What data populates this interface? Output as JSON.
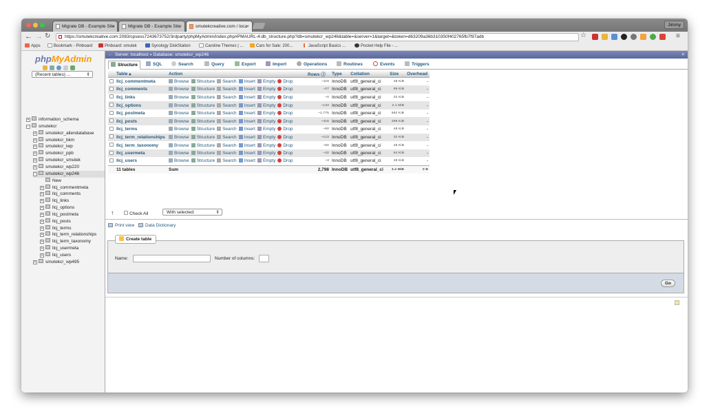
{
  "browser": {
    "tabs": [
      {
        "label": "Migrate DB - Example Site",
        "active": false
      },
      {
        "label": "Migrate DB - Example Site",
        "active": false
      },
      {
        "label": "smutekcreative.com / loca",
        "active": true
      }
    ],
    "user": "Jimmy",
    "url": "https://smutekcreative.com:2083/cpsess7243673752/3rdparty/phpMyAdmin/index.php#PMAURL-4:db_structure.php?db=smutekcr_wp246&table=&server=1&target=&token=d63209a36b310350f402765fb7f97adb",
    "bookmarks": [
      "Apps",
      "Bookmark - Pinboard",
      "Pinboard: smutek",
      "Synology DiskStation",
      "Caroline Themes | ...",
      "Cars for Sale: 200...",
      "JavaScript Basics ...",
      "Pocket Help File - ..."
    ]
  },
  "sidebar": {
    "logo_php": "php",
    "logo_my": "MyAdmin",
    "recent": "(Recent tables) ...",
    "tree": [
      {
        "label": "information_schema",
        "level": 0,
        "sign": "+"
      },
      {
        "label": "smutekcr",
        "level": 0,
        "sign": "-"
      },
      {
        "label": "smutekcr_aliendatabase",
        "level": 1,
        "sign": "+"
      },
      {
        "label": "smutekcr_bkm",
        "level": 1,
        "sign": "+"
      },
      {
        "label": "smutekcr_iwp",
        "level": 1,
        "sign": "+"
      },
      {
        "label": "smutekcr_ppb",
        "level": 1,
        "sign": "+"
      },
      {
        "label": "smutekcr_smutek",
        "level": 1,
        "sign": "+"
      },
      {
        "label": "smutekcr_wp220",
        "level": 1,
        "sign": "+"
      },
      {
        "label": "smutekcr_wp246",
        "level": 1,
        "sign": "-",
        "selected": true
      },
      {
        "label": "New",
        "level": 2,
        "sign": ""
      },
      {
        "label": "llcj_commentmeta",
        "level": 2,
        "sign": "+"
      },
      {
        "label": "llcj_comments",
        "level": 2,
        "sign": "+"
      },
      {
        "label": "llcj_links",
        "level": 2,
        "sign": "+"
      },
      {
        "label": "llcj_options",
        "level": 2,
        "sign": "+"
      },
      {
        "label": "llcj_postmeta",
        "level": 2,
        "sign": "+"
      },
      {
        "label": "llcj_posts",
        "level": 2,
        "sign": "+"
      },
      {
        "label": "llcj_terms",
        "level": 2,
        "sign": "+"
      },
      {
        "label": "llcj_term_relationships",
        "level": 2,
        "sign": "+"
      },
      {
        "label": "llcj_term_taxonomy",
        "level": 2,
        "sign": "+"
      },
      {
        "label": "llcj_usermeta",
        "level": 2,
        "sign": "+"
      },
      {
        "label": "llcj_users",
        "level": 2,
        "sign": "+"
      },
      {
        "label": "smutekcr_wp495",
        "level": 1,
        "sign": "+"
      }
    ]
  },
  "breadcrumb": "Server: localhost » Database: smutekcr_wp246",
  "tabs": [
    "Structure",
    "SQL",
    "Search",
    "Query",
    "Export",
    "Import",
    "Operations",
    "Routines",
    "Events",
    "Triggers"
  ],
  "table": {
    "headers": {
      "table": "Table",
      "action": "Action",
      "rows": "Rows",
      "type": "Type",
      "collation": "Collation",
      "size": "Size",
      "overhead": "Overhead"
    },
    "actions": [
      "Browse",
      "Structure",
      "Search",
      "Insert",
      "Empty",
      "Drop"
    ],
    "rows": [
      {
        "name": "llcj_commentmeta",
        "rows": "~119",
        "type": "InnoDB",
        "collation": "utf8_general_ci",
        "size": "48 KiB",
        "overhead": "-"
      },
      {
        "name": "llcj_comments",
        "rows": "~27",
        "type": "InnoDB",
        "collation": "utf8_general_ci",
        "size": "96 KiB",
        "overhead": "-"
      },
      {
        "name": "llcj_links",
        "rows": "~0",
        "type": "InnoDB",
        "collation": "utf8_general_ci",
        "size": "32 KiB",
        "overhead": "-"
      },
      {
        "name": "llcj_options",
        "rows": "~133",
        "type": "InnoDB",
        "collation": "utf8_general_ci",
        "size": "2.1 MiB",
        "overhead": "-"
      },
      {
        "name": "llcj_postmeta",
        "rows": "~1,775",
        "type": "InnoDB",
        "collation": "utf8_general_ci",
        "size": "592 KiB",
        "overhead": "-"
      },
      {
        "name": "llcj_posts",
        "rows": "~416",
        "type": "InnoDB",
        "collation": "utf8_general_ci",
        "size": "288 KiB",
        "overhead": "-"
      },
      {
        "name": "llcj_terms",
        "rows": "~50",
        "type": "InnoDB",
        "collation": "utf8_general_ci",
        "size": "48 KiB",
        "overhead": "-"
      },
      {
        "name": "llcj_term_relationships",
        "rows": "~123",
        "type": "InnoDB",
        "collation": "utf8_general_ci",
        "size": "32 KiB",
        "overhead": "-"
      },
      {
        "name": "llcj_term_taxonomy",
        "rows": "~50",
        "type": "InnoDB",
        "collation": "utf8_general_ci",
        "size": "48 KiB",
        "overhead": "-"
      },
      {
        "name": "llcj_usermeta",
        "rows": "~32",
        "type": "InnoDB",
        "collation": "utf8_general_ci",
        "size": "64 KiB",
        "overhead": "-"
      },
      {
        "name": "llcj_users",
        "rows": "~3",
        "type": "InnoDB",
        "collation": "utf8_general_ci",
        "size": "48 KiB",
        "overhead": "-"
      }
    ],
    "footer": {
      "count": "11 tables",
      "label": "Sum",
      "rows": "2,798",
      "type": "InnoDB",
      "collation": "utf8_general_ci",
      "size": "3.4 MiB",
      "overhead": "0 B"
    }
  },
  "bulk": {
    "check_all": "Check All",
    "with_selected": "With selected:"
  },
  "links": {
    "print": "Print view",
    "dictionary": "Data Dictionary"
  },
  "create": {
    "legend": "Create table",
    "name_label": "Name:",
    "columns_label": "Number of columns:",
    "go": "Go"
  }
}
